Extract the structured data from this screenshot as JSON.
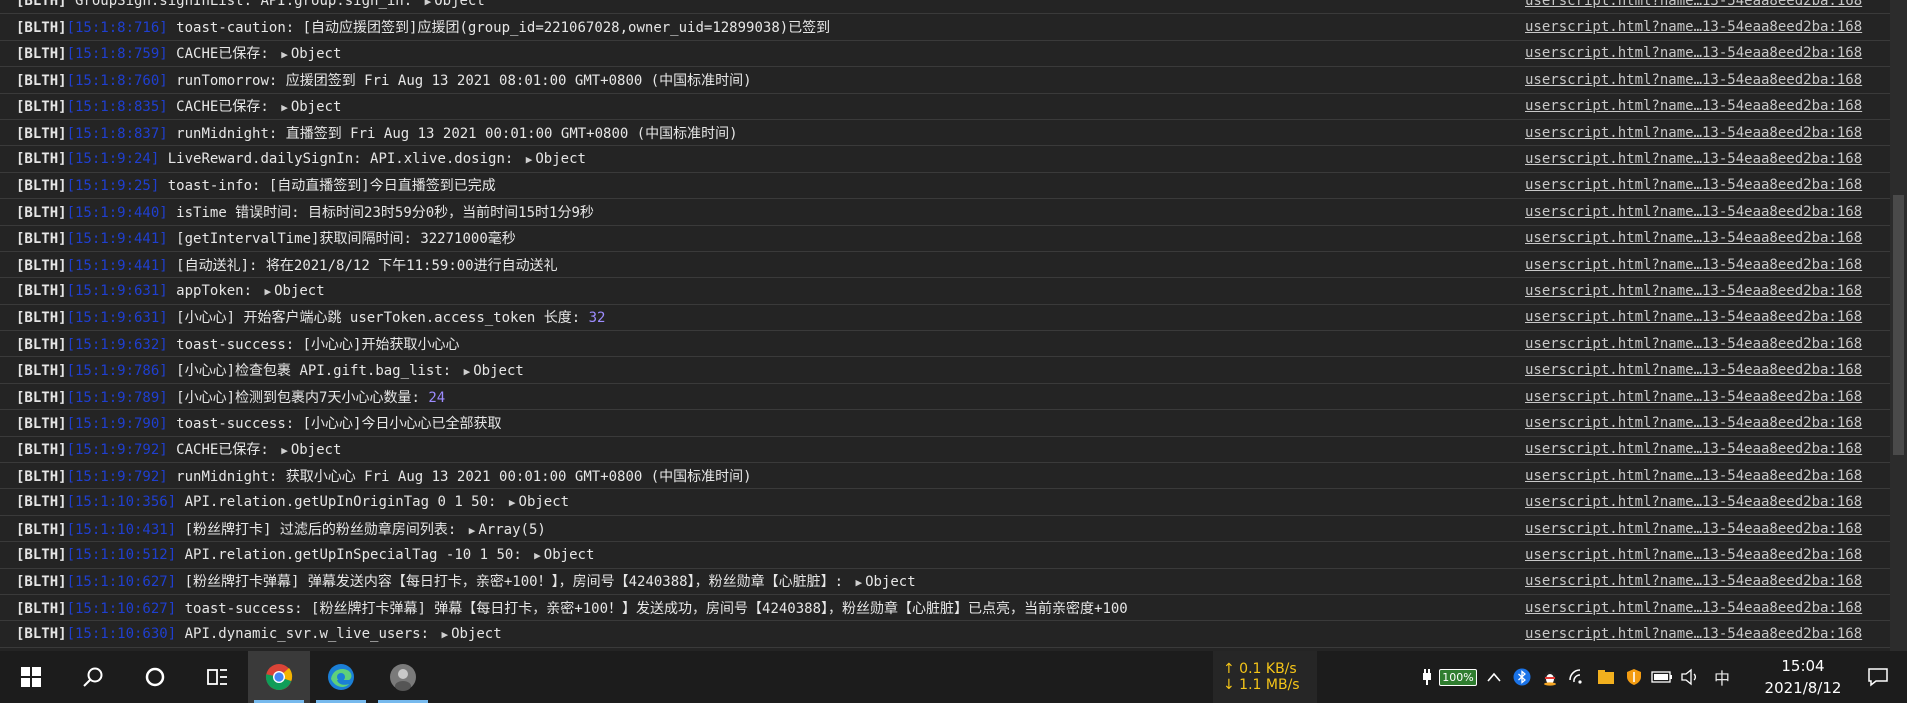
{
  "console": {
    "rows": [
      {
        "tag": "[BLTH]",
        "ts": "",
        "text": "GroupSign.signInList: API.group.sign_in: ",
        "obj": "Object",
        "num": "",
        "after": ""
      },
      {
        "tag": "[BLTH]",
        "ts": "[15:1:8:716]",
        "text": "toast-caution: [自动应援团签到]应援团(group_id=221067028,owner_uid=12899038)已签到",
        "obj": "",
        "num": "",
        "after": ""
      },
      {
        "tag": "[BLTH]",
        "ts": "[15:1:8:759]",
        "text": "CACHE已保存: ",
        "obj": "Object",
        "num": "",
        "after": ""
      },
      {
        "tag": "[BLTH]",
        "ts": "[15:1:8:760]",
        "text": "runTomorrow: 应援团签到 Fri Aug 13 2021 08:01:00 GMT+0800 (中国标准时间)",
        "obj": "",
        "num": "",
        "after": ""
      },
      {
        "tag": "[BLTH]",
        "ts": "[15:1:8:835]",
        "text": "CACHE已保存: ",
        "obj": "Object",
        "num": "",
        "after": ""
      },
      {
        "tag": "[BLTH]",
        "ts": "[15:1:8:837]",
        "text": "runMidnight: 直播签到 Fri Aug 13 2021 00:01:00 GMT+0800 (中国标准时间)",
        "obj": "",
        "num": "",
        "after": ""
      },
      {
        "tag": "[BLTH]",
        "ts": "[15:1:9:24]",
        "text": "LiveReward.dailySignIn: API.xlive.dosign: ",
        "obj": "Object",
        "num": "",
        "after": ""
      },
      {
        "tag": "[BLTH]",
        "ts": "[15:1:9:25]",
        "text": "toast-info: [自动直播签到]今日直播签到已完成",
        "obj": "",
        "num": "",
        "after": ""
      },
      {
        "tag": "[BLTH]",
        "ts": "[15:1:9:440]",
        "text": "isTime 错误时间: 目标时间23时59分0秒，当前时间15时1分9秒",
        "obj": "",
        "num": "",
        "after": ""
      },
      {
        "tag": "[BLTH]",
        "ts": "[15:1:9:441]",
        "text": "[getIntervalTime]获取间隔时间: 32271000毫秒",
        "obj": "",
        "num": "",
        "after": ""
      },
      {
        "tag": "[BLTH]",
        "ts": "[15:1:9:441]",
        "text": "[自动送礼]: 将在2021/8/12 下午11:59:00进行自动送礼",
        "obj": "",
        "num": "",
        "after": ""
      },
      {
        "tag": "[BLTH]",
        "ts": "[15:1:9:631]",
        "text": "appToken: ",
        "obj": "Object",
        "num": "",
        "after": ""
      },
      {
        "tag": "[BLTH]",
        "ts": "[15:1:9:631]",
        "text": "[小心心] 开始客户端心跳 userToken.access_token 长度: ",
        "obj": "",
        "num": "32",
        "after": ""
      },
      {
        "tag": "[BLTH]",
        "ts": "[15:1:9:632]",
        "text": "toast-success: [小心心]开始获取小心心",
        "obj": "",
        "num": "",
        "after": ""
      },
      {
        "tag": "[BLTH]",
        "ts": "[15:1:9:786]",
        "text": "[小心心]检查包裹 API.gift.bag_list: ",
        "obj": "Object",
        "num": "",
        "after": ""
      },
      {
        "tag": "[BLTH]",
        "ts": "[15:1:9:789]",
        "text": "[小心心]检测到包裹内7天小心心数量: ",
        "obj": "",
        "num": "24",
        "after": ""
      },
      {
        "tag": "[BLTH]",
        "ts": "[15:1:9:790]",
        "text": "toast-success: [小心心]今日小心心已全部获取",
        "obj": "",
        "num": "",
        "after": ""
      },
      {
        "tag": "[BLTH]",
        "ts": "[15:1:9:792]",
        "text": "CACHE已保存: ",
        "obj": "Object",
        "num": "",
        "after": ""
      },
      {
        "tag": "[BLTH]",
        "ts": "[15:1:9:792]",
        "text": "runMidnight: 获取小心心 Fri Aug 13 2021 00:01:00 GMT+0800 (中国标准时间)",
        "obj": "",
        "num": "",
        "after": ""
      },
      {
        "tag": "[BLTH]",
        "ts": "[15:1:10:356]",
        "text": "API.relation.getUpInOriginTag 0 1 50: ",
        "obj": "Object",
        "num": "",
        "after": ""
      },
      {
        "tag": "[BLTH]",
        "ts": "[15:1:10:431]",
        "text": "[粉丝牌打卡] 过滤后的粉丝勋章房间列表: ",
        "obj": "Array(5)",
        "num": "",
        "after": ""
      },
      {
        "tag": "[BLTH]",
        "ts": "[15:1:10:512]",
        "text": "API.relation.getUpInSpecialTag -10 1 50: ",
        "obj": "Object",
        "num": "",
        "after": ""
      },
      {
        "tag": "[BLTH]",
        "ts": "[15:1:10:627]",
        "text": "[粉丝牌打卡弹幕] 弹幕发送内容【每日打卡，亲密+100！】，房间号【4240388】，粉丝勋章【心脏脏】: ",
        "obj": "Object",
        "num": "",
        "after": ""
      },
      {
        "tag": "[BLTH]",
        "ts": "[15:1:10:627]",
        "text": "toast-success: [粉丝牌打卡弹幕] 弹幕【每日打卡，亲密+100！】发送成功，房间号【4240388】，粉丝勋章【心脏脏】已点亮，当前亲密度+100",
        "obj": "",
        "num": "",
        "after": ""
      },
      {
        "tag": "[BLTH]",
        "ts": "[15:1:10:630]",
        "text": "API.dynamic_svr.w_live_users: ",
        "obj": "Object",
        "num": "",
        "after": ""
      }
    ],
    "source_link": "userscript.html?name…13-54eaa8eed2ba:168"
  },
  "taskbar": {
    "apps": [
      {
        "name": "windows-start-icon"
      },
      {
        "name": "search-icon"
      },
      {
        "name": "cortana-icon"
      },
      {
        "name": "task-view-icon"
      },
      {
        "name": "chrome-icon"
      },
      {
        "name": "edge-icon"
      },
      {
        "name": "avatar-app-icon"
      }
    ],
    "net_up": "↑ 0.1 KB/s",
    "net_down": "↓ 1.1 MB/s",
    "battery": "100%",
    "ime": "中",
    "time": "15:04",
    "date": "2021/8/12",
    "colors": {
      "accent": "#76b9ed",
      "timestamp": "#1f3fd0",
      "number": "#9d8cff",
      "net": "#f5c518"
    }
  }
}
